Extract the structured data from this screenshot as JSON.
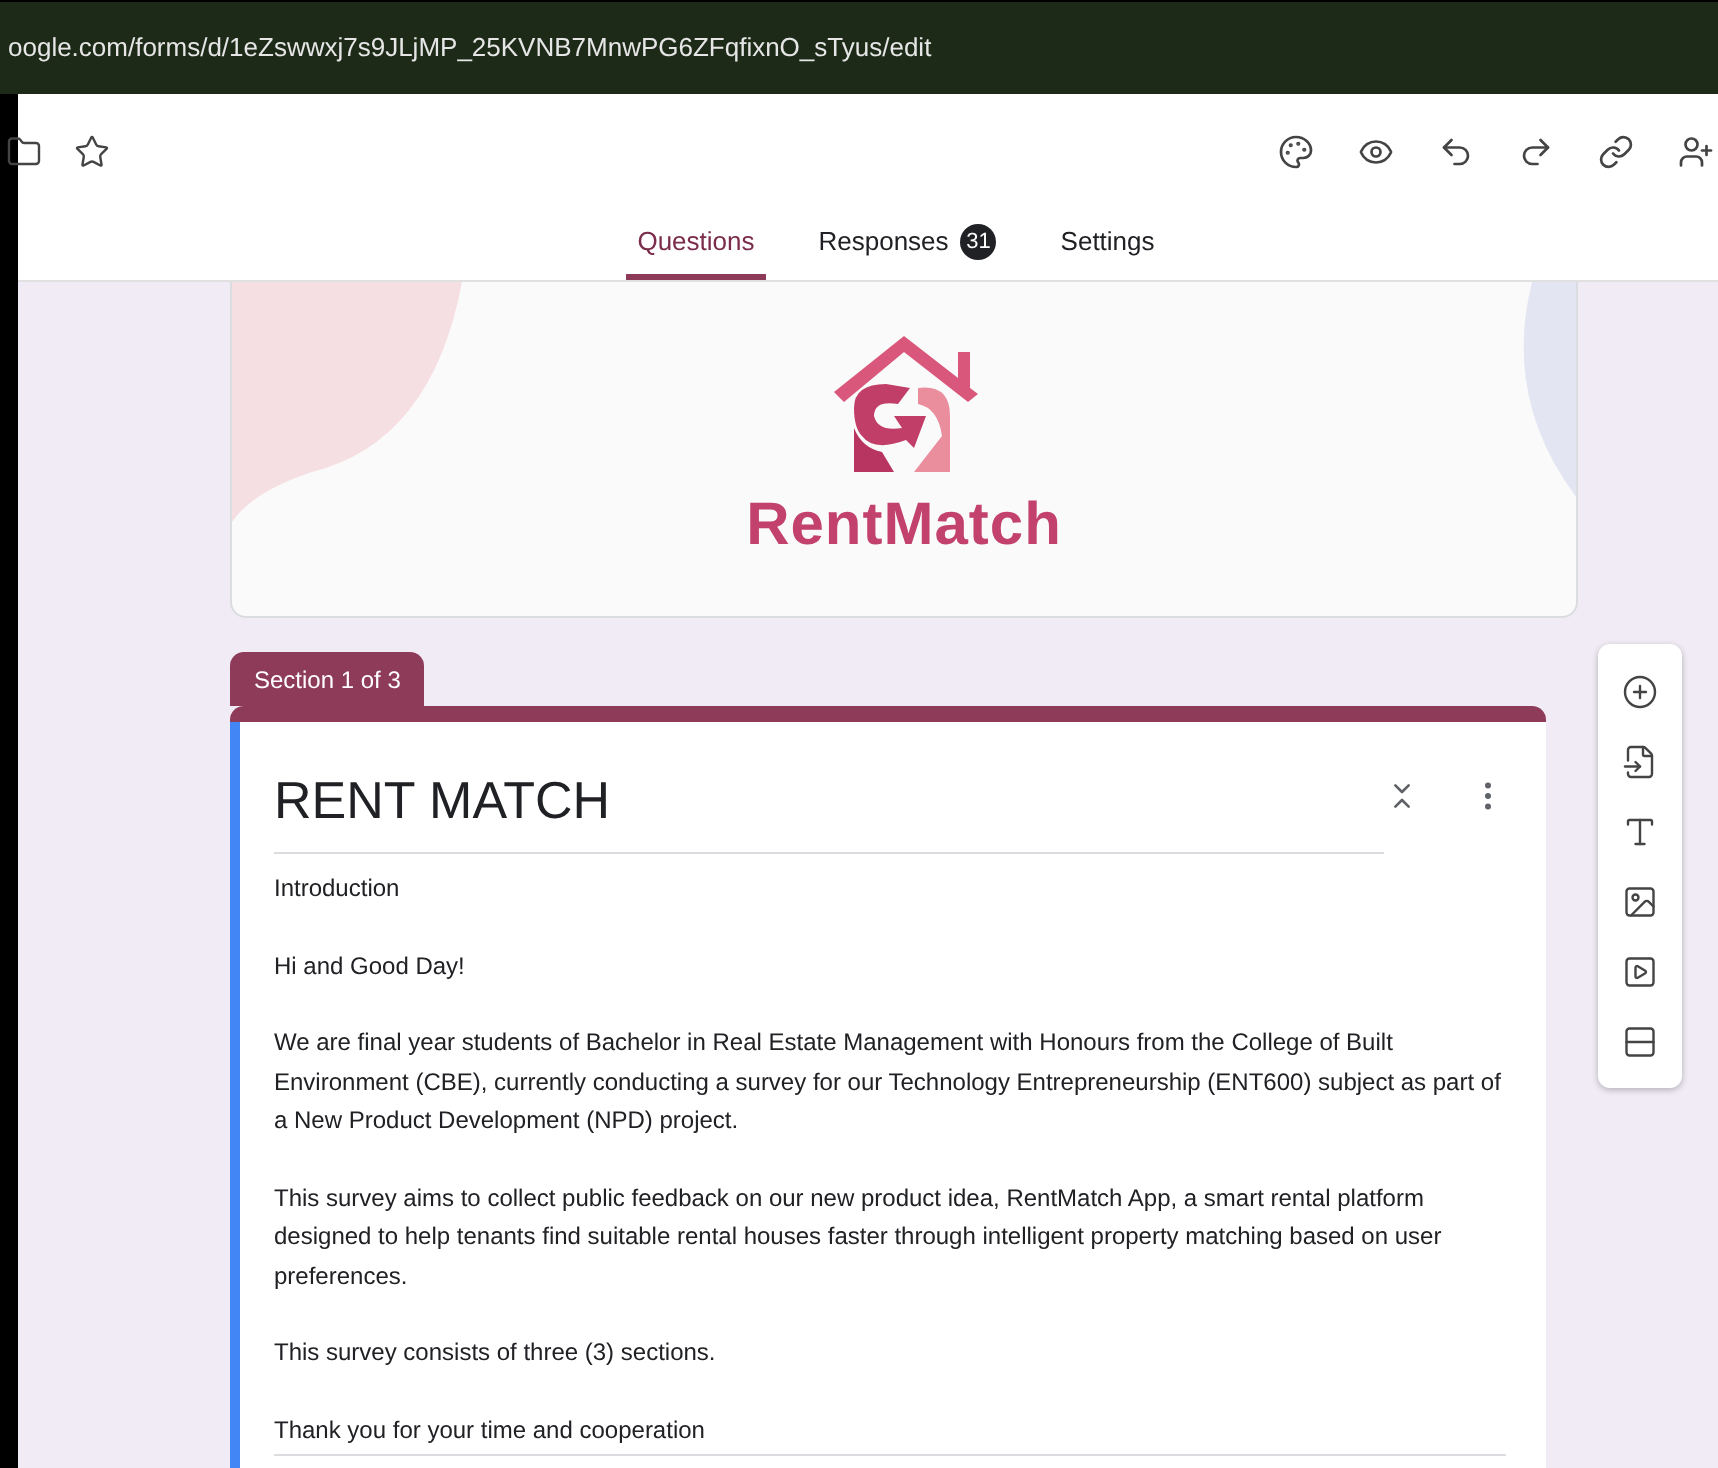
{
  "address_bar": {
    "url": "oogle.com/forms/d/1eZswwxj7s9JLjMP_25KVNB7MnwPG6ZFqfixnO_sTyus/edit"
  },
  "tabs": [
    {
      "label": "Questions",
      "selected": true
    },
    {
      "label": "Responses",
      "selected": false,
      "badge": "31"
    },
    {
      "label": "Settings",
      "selected": false
    }
  ],
  "banner": {
    "logo_text": "RentMatch"
  },
  "section": {
    "label": "Section 1 of 3"
  },
  "form": {
    "title": "RENT MATCH",
    "description": [
      "Introduction",
      "Hi and Good Day!",
      "We are final year students of Bachelor in Real Estate Management with Honours from the College of Built Environment (CBE), currently conducting a survey for our Technology Entrepreneurship (ENT600) subject as part of a New Product Development (NPD) project.",
      "This survey aims to collect public feedback on our new product idea, RentMatch App, a smart rental platform designed to help tenants find suitable rental houses faster through intelligent property matching based on user preferences.",
      "This survey consists of three (3) sections.",
      "Thank you for your time and cooperation"
    ]
  }
}
